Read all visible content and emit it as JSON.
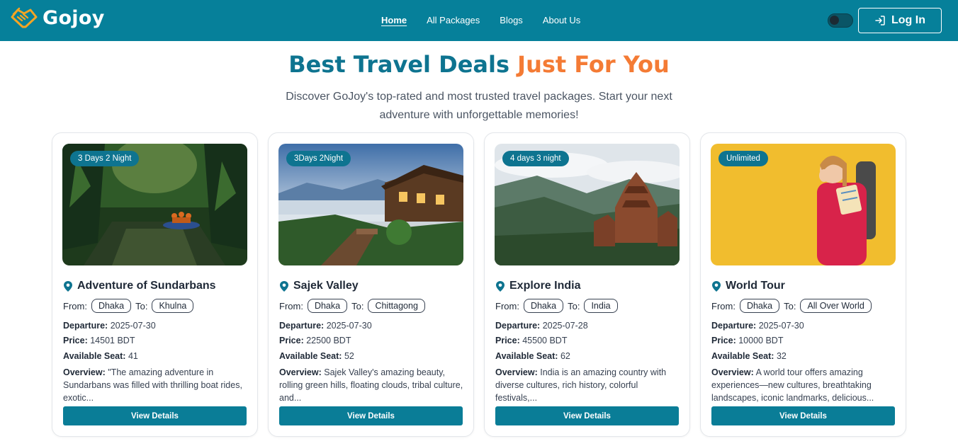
{
  "brand": {
    "name": "Gojoy"
  },
  "nav": {
    "links": [
      "Home",
      "All Packages",
      "Blogs",
      "About Us"
    ],
    "login_label": "Log In"
  },
  "hero": {
    "title_part1": "Best Travel Deals",
    "title_part2": "Just For You",
    "subtitle": "Discover GoJoy's top-rated and most trusted travel packages. Start your next adventure with unforgettable memories!"
  },
  "labels": {
    "from": "From:",
    "to": "To:",
    "departure": "Departure:",
    "price": "Price:",
    "seats": "Available Seat:",
    "overview": "Overview:",
    "view_details": "View Details"
  },
  "packages": [
    {
      "badge": "3 Days 2 Night",
      "title": "Adventure of Sundarbans",
      "from": "Dhaka",
      "to": "Khulna",
      "departure": "2025-07-30",
      "price": "14501 BDT",
      "seats": "41",
      "overview": "\"The amazing adventure in Sundarbans was filled with thrilling boat rides, exotic..."
    },
    {
      "badge": "3Days 2Night",
      "title": "Sajek Valley",
      "from": "Dhaka",
      "to": "Chittagong",
      "departure": "2025-07-30",
      "price": "22500 BDT",
      "seats": "52",
      "overview": "Sajek Valley's amazing beauty, rolling green hills, floating clouds, tribal culture, and..."
    },
    {
      "badge": "4 days 3 night",
      "title": "Explore India",
      "from": "Dhaka",
      "to": "India",
      "departure": "2025-07-28",
      "price": "45500 BDT",
      "seats": "62",
      "overview": "India is an amazing country with diverse cultures, rich history, colorful festivals,..."
    },
    {
      "badge": "Unlimited",
      "title": "World Tour",
      "from": "Dhaka",
      "to": "All Over World",
      "departure": "2025-07-30",
      "price": "10000 BDT",
      "seats": "32",
      "overview": "A world tour offers amazing experiences—new cultures, breathtaking landscapes, iconic landmarks, delicious..."
    }
  ],
  "colors": {
    "primary": "#06809a",
    "accent": "#f47b35",
    "button": "#0a7d97"
  }
}
